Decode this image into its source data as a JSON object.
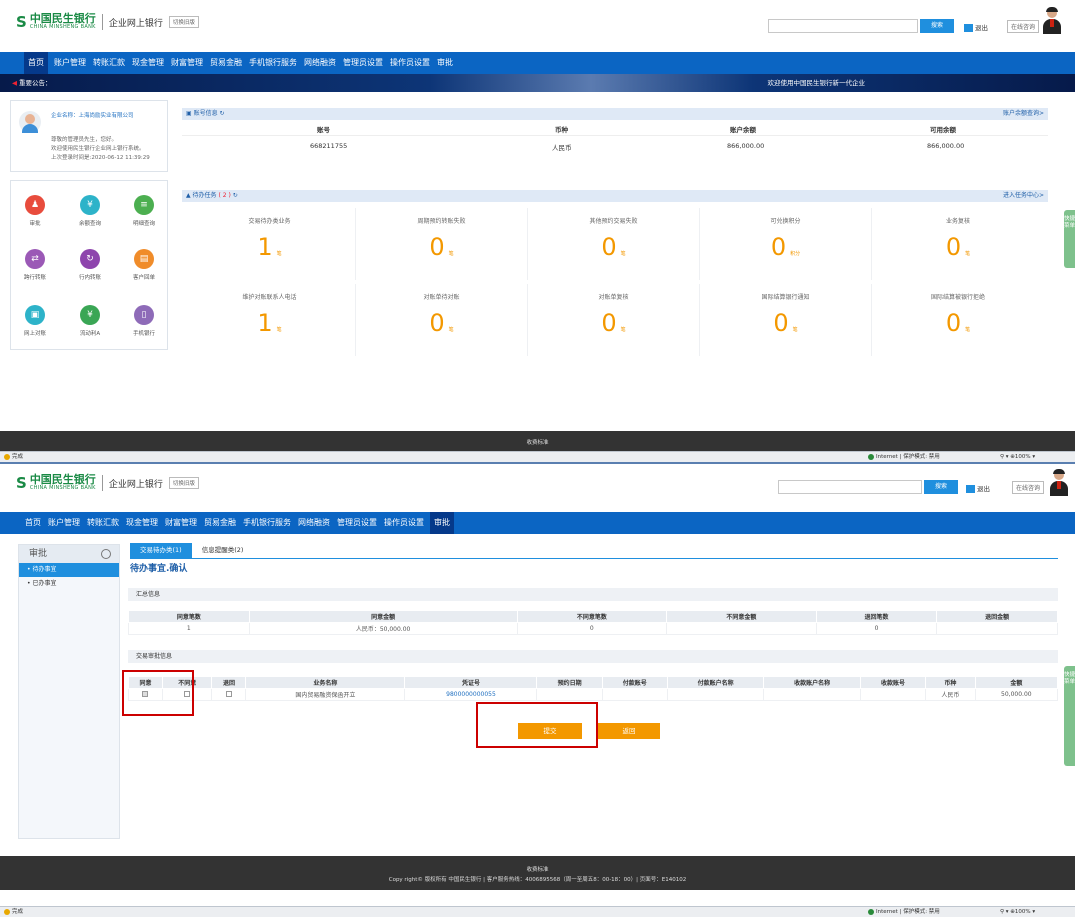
{
  "brand": {
    "cn": "中国民生银行",
    "en": "CHINA MINSHENG BANK",
    "sub": "企业网上银行",
    "old": "切换旧版"
  },
  "header": {
    "search": "搜索",
    "logout": "退出",
    "consult": "在线咨询"
  },
  "nav": [
    "首页",
    "账户管理",
    "转账汇款",
    "现金管理",
    "财富管理",
    "贸易金融",
    "手机银行服务",
    "网络融资",
    "管理员设置",
    "操作员设置",
    "审批"
  ],
  "notice": {
    "label": "重要公告：",
    "welcome": "欢迎使用中国民生银行新一代企业"
  },
  "greeting": {
    "company": "企业名称：上海尚励实业有限公司",
    "hello": "尊敬的管理员先生，您好。",
    "welcome": "欢迎使用民生银行企业网上银行系统。",
    "last": "上次登录时间是:2020-06-12 11:39:29"
  },
  "quick": [
    {
      "label": "审批",
      "color": "#e84c3d",
      "glyph": "♟"
    },
    {
      "label": "余额查询",
      "color": "#2db3c9",
      "glyph": "¥"
    },
    {
      "label": "明细查询",
      "color": "#4caf50",
      "glyph": "≡"
    },
    {
      "label": "跨行转账",
      "color": "#9b59b6",
      "glyph": "⇄"
    },
    {
      "label": "行内转账",
      "color": "#8e44ad",
      "glyph": "↻"
    },
    {
      "label": "客户回单",
      "color": "#f08c2a",
      "glyph": "▤"
    },
    {
      "label": "网上对账",
      "color": "#2db3c9",
      "glyph": "▣"
    },
    {
      "label": "流动利A",
      "color": "#3aa655",
      "glyph": "¥"
    },
    {
      "label": "手机银行",
      "color": "#8e6bb8",
      "glyph": "▯"
    }
  ],
  "account": {
    "title": "账号信息",
    "link": "账户余额查询>",
    "headers": [
      "账号",
      "币种",
      "账户余额",
      "可用余额"
    ],
    "row": [
      "668211755",
      "人民币",
      "866,000.00",
      "866,000.00"
    ]
  },
  "tasks": {
    "title": "待办任务",
    "count": "( 2 )",
    "link": "进入任务中心>",
    "items": [
      {
        "label": "交易待办类业务",
        "num": "1",
        "unit": "笔"
      },
      {
        "label": "周期预约转账失败",
        "num": "0",
        "unit": "笔"
      },
      {
        "label": "其他预约交易失败",
        "num": "0",
        "unit": "笔"
      },
      {
        "label": "可兑换积分",
        "num": "0",
        "unit": "积分"
      },
      {
        "label": "业务复核",
        "num": "0",
        "unit": "笔"
      },
      {
        "label": "维护对账联系人电话",
        "num": "1",
        "unit": "笔"
      },
      {
        "label": "对账单待对账",
        "num": "0",
        "unit": "笔"
      },
      {
        "label": "对账单复核",
        "num": "0",
        "unit": "笔"
      },
      {
        "label": "国际结算银行通知",
        "num": "0",
        "unit": "笔"
      },
      {
        "label": "国际结算被银行拒绝",
        "num": "0",
        "unit": "笔"
      }
    ]
  },
  "sidetab": "快捷菜单",
  "footer1": "收费标准",
  "status": {
    "done": "完成",
    "zone": "Internet | 保护模式: 禁用",
    "zoom": "100%"
  },
  "approval": {
    "side_title": "审批",
    "side_items": [
      "待办事宜",
      "已办事宜"
    ],
    "tabs": [
      "交易待办类(1)",
      "信息提醒类(2)"
    ],
    "title": "待办事宜.确认",
    "summary_title": "汇总信息",
    "summary_headers": [
      "同意笔数",
      "同意金额",
      "不同意笔数",
      "不同意金额",
      "退回笔数",
      "退回金额"
    ],
    "summary_row": [
      "1",
      "人民币：50,000.00",
      "0",
      "",
      "0",
      ""
    ],
    "detail_title": "交易审批信息",
    "detail_headers": [
      "同意",
      "不同意",
      "退回",
      "业务名称",
      "凭证号",
      "预约日期",
      "付款账号",
      "付款账户名称",
      "收款账户名称",
      "收款账号",
      "币种",
      "金额"
    ],
    "detail_row": [
      "国内贸易融资保函开立",
      "9800000000055",
      "",
      "",
      "",
      "",
      "",
      "人民币",
      "50,000.00"
    ],
    "submit": "提交",
    "back": "返回"
  },
  "footer2": {
    "l1": "收费标准",
    "l2": "Copy right© 版权所有 中国民生银行 | 客户服务热线：4006895568（周一至周五8：00-18：00）| 页面号：E140102"
  }
}
